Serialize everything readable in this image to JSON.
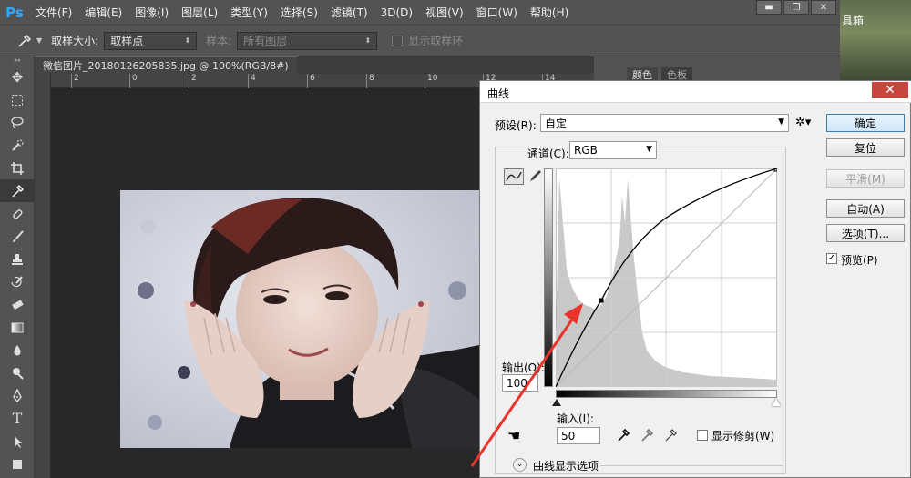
{
  "app": {
    "logo": "Ps",
    "menu": [
      "文件(F)",
      "编辑(E)",
      "图像(I)",
      "图层(L)",
      "类型(Y)",
      "选择(S)",
      "滤镜(T)",
      "3D(D)",
      "视图(V)",
      "窗口(W)",
      "帮助(H)"
    ],
    "window_controls": [
      "▬",
      "❐",
      "✕"
    ],
    "background_app_text": "具箱"
  },
  "options_bar": {
    "tool_icon": "eyedropper-icon",
    "sample_size_label": "取样大小:",
    "sample_size_value": "取样点",
    "sample_label": "样本:",
    "sample_value": "所有图层",
    "show_ring_label": "显示取样环"
  },
  "document": {
    "tab_title": "微信图片_20180126205835.jpg @ 100%(RGB/8#)",
    "tab_close": "×",
    "ruler_ticks": [
      "2",
      "0",
      "2",
      "4",
      "6",
      "8",
      "10",
      "12",
      "14"
    ]
  },
  "right_panel": {
    "tabs": [
      "颜色",
      "色板"
    ]
  },
  "dialog": {
    "title": "曲线",
    "close": "✕",
    "preset_label": "预设(R):",
    "preset_value": "自定",
    "channel_label": "通道(C):",
    "channel_value": "RGB",
    "output_label": "输出(O):",
    "output_value": "100",
    "input_label": "输入(I):",
    "input_value": "50",
    "show_clipping_label": "显示修剪(W)",
    "curve_display_options": "曲线显示选项",
    "buttons": {
      "ok": "确定",
      "reset": "复位",
      "smooth": "平滑(M)",
      "auto": "自动(A)",
      "options": "选项(T)..."
    },
    "preview_label": "预览(P)",
    "preview_checked": true
  },
  "colors": {
    "ui_dark": "#535353",
    "canvas": "#282828",
    "dialog_bg": "#f0f0f0",
    "annotation_arrow": "#e8342c",
    "ps_blue": "#31a8ff"
  }
}
